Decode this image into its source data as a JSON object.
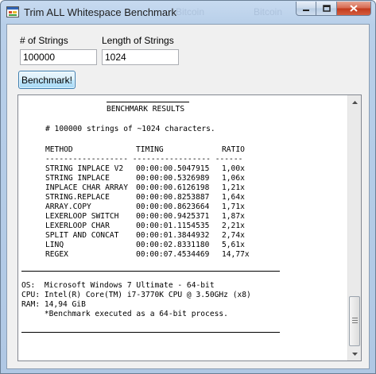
{
  "window": {
    "title": "Trim ALL Whitespace Benchmark",
    "ghost_text_1": "Bitcoin",
    "ghost_text_2": "Bitcoin"
  },
  "form": {
    "num_strings_label": "# of Strings",
    "num_strings_value": "100000",
    "length_label": "Length of Strings",
    "length_value": "1024",
    "benchmark_button": "Benchmark!"
  },
  "results": {
    "heading": "BENCHMARK RESULTS",
    "summary": "# 100000 strings of ~1024 characters.",
    "columns": {
      "method": "METHOD",
      "timing": "TIMING",
      "ratio": "RATIO"
    },
    "separator": "------------------ ----------------- ------",
    "rows": [
      {
        "method": "STRING INPLACE V2",
        "timing": "00:00:00.5047915",
        "ratio": "1,00x"
      },
      {
        "method": "STRING INPLACE",
        "timing": "00:00:00.5326989",
        "ratio": "1,06x"
      },
      {
        "method": "INPLACE CHAR ARRAY",
        "timing": "00:00:00.6126198",
        "ratio": "1,21x"
      },
      {
        "method": "STRING.REPLACE",
        "timing": "00:00:00.8253887",
        "ratio": "1,64x"
      },
      {
        "method": "ARRAY.COPY",
        "timing": "00:00:00.8623664",
        "ratio": "1,71x"
      },
      {
        "method": "LEXERLOOP SWITCH",
        "timing": "00:00:00.9425371",
        "ratio": "1,87x"
      },
      {
        "method": "LEXERLOOP CHAR",
        "timing": "00:00:01.1154535",
        "ratio": "2,21x"
      },
      {
        "method": "SPLIT AND CONCAT",
        "timing": "00:00:01.3844932",
        "ratio": "2,74x"
      },
      {
        "method": "LINQ",
        "timing": "00:00:02.8331180",
        "ratio": "5,61x"
      },
      {
        "method": "REGEX",
        "timing": "00:00:07.4534469",
        "ratio": "14,77x"
      }
    ],
    "system": {
      "os_line": "OS:  Microsoft Windows 7 Ultimate - 64-bit",
      "cpu_line": "CPU: Intel(R) Core(TM) i7-3770K CPU @ 3.50GHz (x8)",
      "ram_line": "RAM: 14,94 GiB",
      "note_line": "     *Benchmark executed as a 64-bit process."
    }
  },
  "colors": {
    "titlebar": "#b8cfe9",
    "client": "#f0f0f0",
    "close": "#c2391b"
  }
}
